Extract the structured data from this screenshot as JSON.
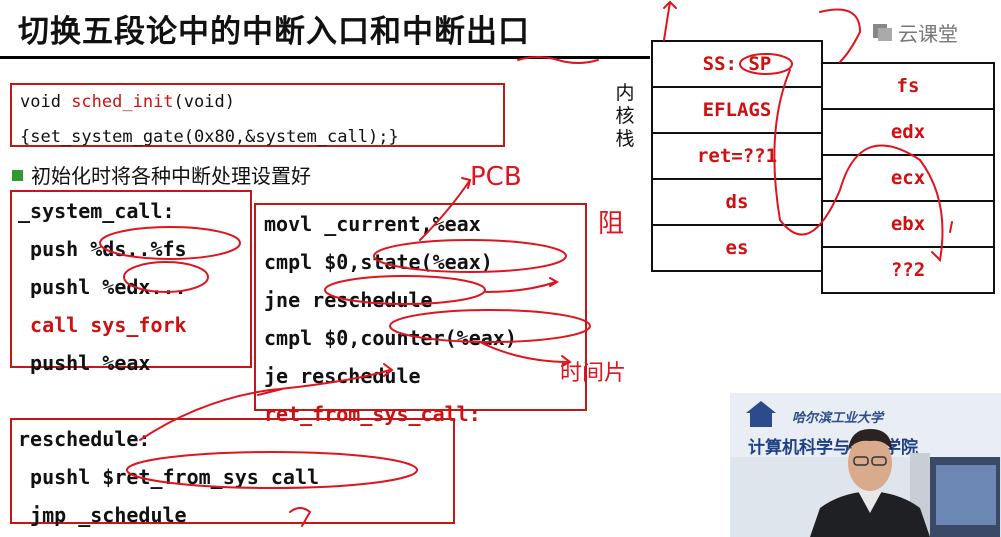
{
  "title": "切换五段论中的中断入口和中断出口",
  "brand": {
    "name": "云课堂",
    "icon": "cloud-class-logo-icon"
  },
  "init_box": {
    "line1_a": "void ",
    "line1_b": "sched_init",
    "line1_c": "(void)",
    "line2": "{set_system_gate(0x80,&system_call);}"
  },
  "bullet": "初始化时将各种中断处理设置好",
  "system_call_box": {
    "label": "_system_call:",
    "lines": [
      "push %ds..%fs",
      "pushl %edx...",
      "call sys_fork",
      "pushl %eax"
    ]
  },
  "main_box": {
    "lines": [
      "movl _current,%eax",
      "cmpl $0,state(%eax)",
      "jne reschedule",
      "cmpl $0,counter(%eax)",
      "je reschedule",
      "ret_from_sys_call:"
    ]
  },
  "reschedule_box": {
    "lines": [
      "reschedule:",
      "pushl $ret_from_sys_call",
      "jmp _schedule"
    ]
  },
  "kernel_stack_label": [
    "内",
    "核",
    "栈"
  ],
  "stack_left": [
    "SS: SP",
    "EFLAGS",
    "ret=??1",
    "ds",
    "es"
  ],
  "stack_right": [
    "fs",
    "edx",
    "ecx",
    "ebx",
    "??2"
  ],
  "annotations": {
    "pcb": "PCB",
    "block": "阻",
    "time_slice": "时间片"
  },
  "video": {
    "school": "哈尔滨工业大学",
    "dept": "计算机科学与技术学院"
  },
  "colors": {
    "accent_red": "#d01010",
    "box_border": "#c21818",
    "bullet_green": "#2f9a2f",
    "text": "#111111"
  }
}
